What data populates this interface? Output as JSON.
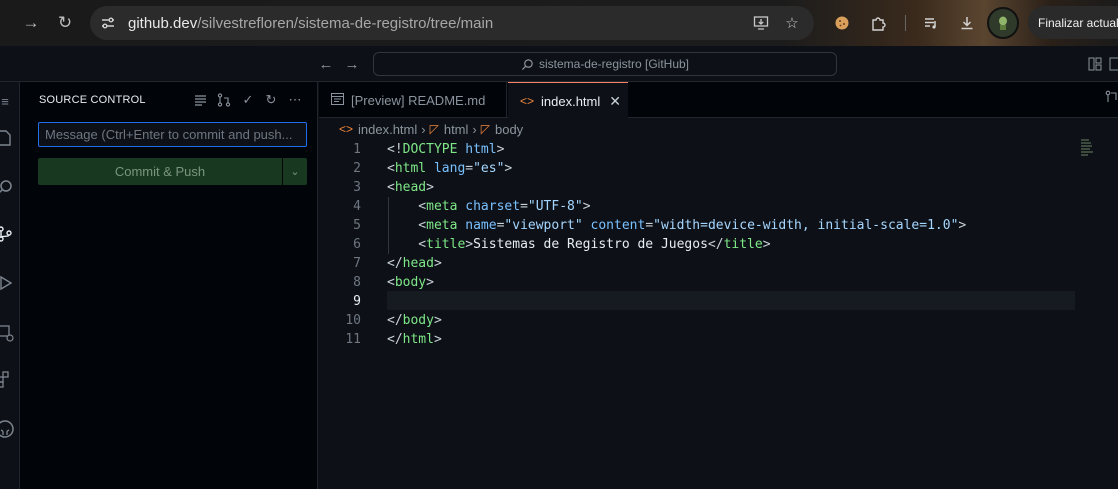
{
  "browser": {
    "url_host": "github.dev",
    "url_path": "/silvestrefloren/sistema-de-registro/tree/main",
    "update_button_label": "Finalizar actuali"
  },
  "title_bar": {
    "command_center_label": "sistema-de-registro [GitHub]"
  },
  "sidebar": {
    "title": "SOURCE CONTROL",
    "message_placeholder": "Message (Ctrl+Enter to commit and push...",
    "message_value": "",
    "commit_button_label": "Commit & Push"
  },
  "tabs": [
    {
      "label": "[Preview] README.md",
      "active": false
    },
    {
      "label": "index.html",
      "active": true
    }
  ],
  "breadcrumb": [
    "index.html",
    "html",
    "body"
  ],
  "editor": {
    "active_line": 9,
    "line_numbers": [
      "1",
      "2",
      "3",
      "4",
      "5",
      "6",
      "7",
      "8",
      "9",
      "10",
      "11"
    ],
    "lines": [
      [
        {
          "t": "<!",
          "c": "punct"
        },
        {
          "t": "DOCTYPE",
          "c": "tag"
        },
        {
          "t": " ",
          "c": "punct"
        },
        {
          "t": "html",
          "c": "attr"
        },
        {
          "t": ">",
          "c": "punct"
        }
      ],
      [
        {
          "t": "<",
          "c": "punct"
        },
        {
          "t": "html",
          "c": "tag"
        },
        {
          "t": " ",
          "c": "punct"
        },
        {
          "t": "lang",
          "c": "attr"
        },
        {
          "t": "=",
          "c": "punct"
        },
        {
          "t": "\"es\"",
          "c": "str"
        },
        {
          "t": ">",
          "c": "punct"
        }
      ],
      [
        {
          "t": "<",
          "c": "punct"
        },
        {
          "t": "head",
          "c": "tag"
        },
        {
          "t": ">",
          "c": "punct"
        }
      ],
      [
        {
          "t": "    <",
          "c": "punct"
        },
        {
          "t": "meta",
          "c": "tag"
        },
        {
          "t": " ",
          "c": "punct"
        },
        {
          "t": "charset",
          "c": "attr"
        },
        {
          "t": "=",
          "c": "punct"
        },
        {
          "t": "\"UTF-8\"",
          "c": "str"
        },
        {
          "t": ">",
          "c": "punct"
        }
      ],
      [
        {
          "t": "    <",
          "c": "punct"
        },
        {
          "t": "meta",
          "c": "tag"
        },
        {
          "t": " ",
          "c": "punct"
        },
        {
          "t": "name",
          "c": "attr"
        },
        {
          "t": "=",
          "c": "punct"
        },
        {
          "t": "\"viewport\"",
          "c": "str"
        },
        {
          "t": " ",
          "c": "punct"
        },
        {
          "t": "content",
          "c": "attr"
        },
        {
          "t": "=",
          "c": "punct"
        },
        {
          "t": "\"width=device-width, initial-scale=1.0\"",
          "c": "str"
        },
        {
          "t": ">",
          "c": "punct"
        }
      ],
      [
        {
          "t": "    <",
          "c": "punct"
        },
        {
          "t": "title",
          "c": "tag"
        },
        {
          "t": ">",
          "c": "punct"
        },
        {
          "t": "Sistemas de Registro de Juegos",
          "c": "text"
        },
        {
          "t": "</",
          "c": "punct"
        },
        {
          "t": "title",
          "c": "tag"
        },
        {
          "t": ">",
          "c": "punct"
        }
      ],
      [
        {
          "t": "</",
          "c": "punct"
        },
        {
          "t": "head",
          "c": "tag"
        },
        {
          "t": ">",
          "c": "punct"
        }
      ],
      [
        {
          "t": "<",
          "c": "punct"
        },
        {
          "t": "body",
          "c": "tag"
        },
        {
          "t": ">",
          "c": "punct"
        }
      ],
      [],
      [
        {
          "t": "</",
          "c": "punct"
        },
        {
          "t": "body",
          "c": "tag"
        },
        {
          "t": ">",
          "c": "punct"
        }
      ],
      [
        {
          "t": "</",
          "c": "punct"
        },
        {
          "t": "html",
          "c": "tag"
        },
        {
          "t": ">",
          "c": "punct"
        }
      ]
    ]
  },
  "icons": {
    "accent_tab_border": "#f78166",
    "commit_button_bg": "#18391f",
    "input_focus_border": "#1f6feb"
  }
}
